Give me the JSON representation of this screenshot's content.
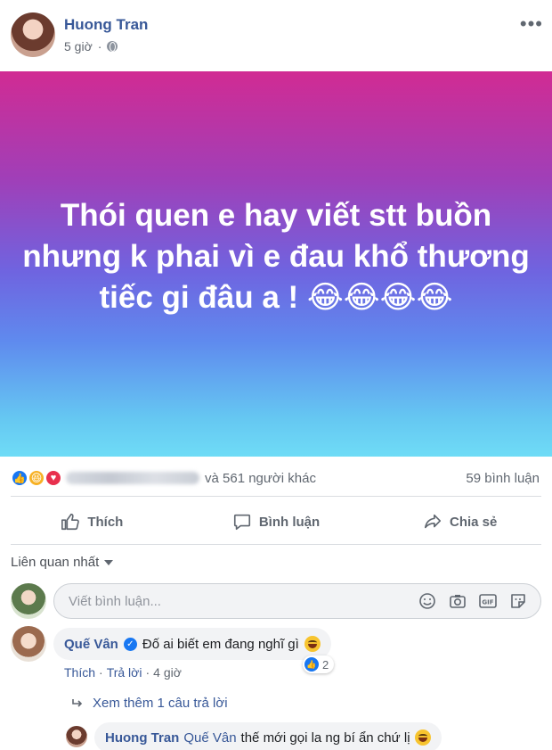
{
  "post": {
    "author": "Huong Tran",
    "time": "5 giờ",
    "privacy_icon": "globe-icon",
    "text": "Thói quen e hay viết stt buồn nhưng k phai vì e đau khổ thương tiếc gi đâu a ! 😂😂😂😂",
    "background": {
      "top": "#d12b93",
      "middle": "#6f64e0",
      "bottom": "#6fdcf6"
    }
  },
  "reactions": {
    "icons": [
      "like-icon",
      "haha-icon",
      "love-icon"
    ],
    "summary": "và 561 người khác",
    "comments_count": "59 bình luận"
  },
  "actions": {
    "like": "Thích",
    "comment": "Bình luận",
    "share": "Chia sẻ"
  },
  "sort": {
    "label": "Liên quan nhất"
  },
  "composer": {
    "placeholder": "Viết bình luận...",
    "icons": [
      "emoji-icon",
      "camera-icon",
      "gif-icon",
      "sticker-icon"
    ]
  },
  "comment": {
    "author": "Quế Vân",
    "verified": true,
    "text": "Đố ai biết em đang nghĩ gì",
    "like_label": "Thích",
    "reply_label": "Trả lời",
    "time": "4 giờ",
    "reaction_count": "2"
  },
  "see_more": "Xem thêm 1 câu trả lời",
  "reply": {
    "author": "Huong Tran",
    "mention": "Quế Vân",
    "text": "thế mới gọi la ng bí ẩn chứ lị"
  },
  "colors": {
    "link": "#385898",
    "accent": "#1877f2",
    "muted": "#606770"
  }
}
